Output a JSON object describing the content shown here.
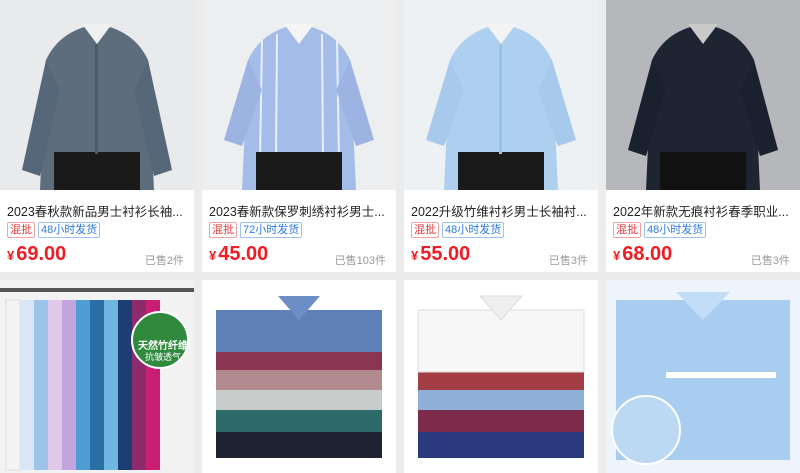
{
  "products": [
    {
      "title": "2023春秋款新品男士衬衫长袖...",
      "tag_mix": "混批",
      "tag_ship": "48小时发货",
      "currency": "¥",
      "price": "69.00",
      "sold": "已售2件",
      "color": "#5a6b7a"
    },
    {
      "title": "2023春新款保罗刺绣衬衫男士...",
      "tag_mix": "混批",
      "tag_ship": "72小时发货",
      "currency": "¥",
      "price": "45.00",
      "sold": "已售103件",
      "color": "#9db7e4"
    },
    {
      "title": "2022升级竹维衬衫男士长袖衬...",
      "tag_mix": "混批",
      "tag_ship": "48小时发货",
      "currency": "¥",
      "price": "55.00",
      "sold": "已售3件",
      "color": "#a9cdee"
    },
    {
      "title": "2022年新款无痕衬衫春季职业...",
      "tag_mix": "混批",
      "tag_ship": "48小时发货",
      "currency": "¥",
      "price": "68.00",
      "sold": "已售3件",
      "color": "#1c2130"
    }
  ],
  "bottom_images": [
    {
      "label": "天然竹纤维",
      "sublabel": "抗皱透气"
    },
    {},
    {},
    {}
  ]
}
